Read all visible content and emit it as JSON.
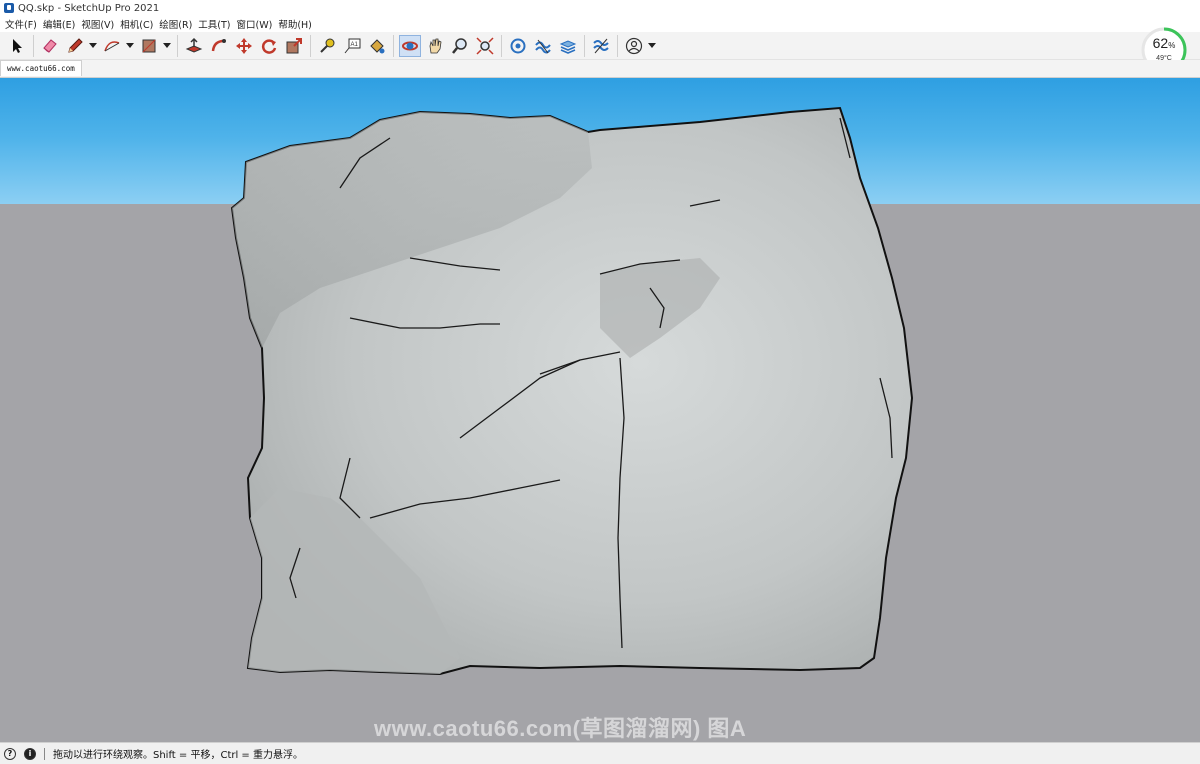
{
  "window": {
    "title": "QQ.skp - SketchUp Pro 2021"
  },
  "menu": [
    "文件(F)",
    "编辑(E)",
    "视图(V)",
    "相机(C)",
    "绘图(R)",
    "工具(T)",
    "窗口(W)",
    "帮助(H)"
  ],
  "toolbar": {
    "tools": [
      "select-icon",
      "eraser-icon",
      "pencil-icon",
      "arc-icon",
      "rectangle-icon",
      "push-pull-icon",
      "follow-me-icon",
      "move-icon",
      "rotate-icon",
      "scale-icon",
      "tape-measure-icon",
      "text-icon",
      "paint-bucket-icon",
      "orbit-icon",
      "pan-icon",
      "zoom-icon",
      "zoom-extents-icon",
      "geo-location-icon",
      "sandbox-icon",
      "layers-icon",
      "styles-icon",
      "account-icon"
    ],
    "active_tool": "orbit-icon"
  },
  "gauge": {
    "percent": "62",
    "percent_sign": "%",
    "temperature": "49°C",
    "accent": "#3cc45a"
  },
  "scene_tab": {
    "label": "www.caotu66.com"
  },
  "viewport": {
    "sky_color": "#4fb3ea",
    "ground_color": "#a4a4a8",
    "model_color": "#c4c8c8",
    "watermark": "www.caotu66.com(草图溜溜网) 图A"
  },
  "status": {
    "message": "拖动以进行环绕观察。Shift = 平移，Ctrl = 重力悬浮。"
  }
}
